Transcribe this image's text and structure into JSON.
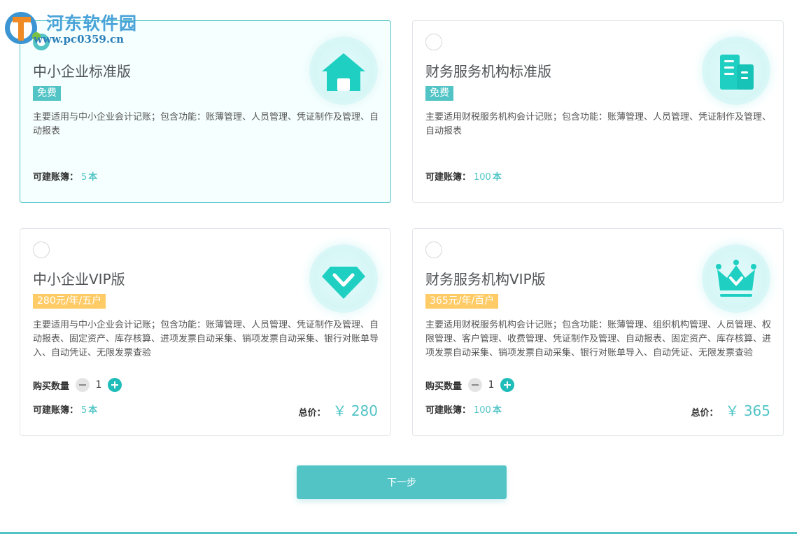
{
  "watermark": {
    "title": "河东软件园",
    "url": "www.pc0359.cn"
  },
  "colors": {
    "accent": "#52c4c6",
    "paid_badge": "#ffcb66",
    "plus_button": "#1fbcb9"
  },
  "plans": [
    {
      "title": "中小企业标准版",
      "badge": "免费",
      "selected": true,
      "icon": "house-icon",
      "description": "主要适用与中小企业会计记账；包含功能：账薄管理、人员管理、凭证制作及管理、自动报表",
      "books_label": "可建账簿：",
      "books_count": "5",
      "books_unit": "本"
    },
    {
      "title": "财务服务机构标准版",
      "badge": "免费",
      "selected": false,
      "icon": "building-icon",
      "description": "主要适用财税服务机构会计记账；包含功能：账薄管理、人员管理、凭证制作及管理、自动报表",
      "books_label": "可建账簿：",
      "books_count": "100",
      "books_unit": "本"
    },
    {
      "title": "中小企业VIP版",
      "badge": "280元/年/五户",
      "selected": false,
      "icon": "diamond-icon",
      "description": "主要适用与中小企业会计记账；包含功能：账薄管理、人员管理、凭证制作及管理、自动报表、固定资产、库存核算、进项发票自动采集、销项发票自动采集、银行对账单导入、自动凭证、无限发票查验",
      "quantity_label": "购买数量",
      "quantity": "1",
      "books_label": "可建账簿：",
      "books_count": "5",
      "books_unit": "本",
      "total_label": "总价：",
      "total_price": "￥ 280"
    },
    {
      "title": "财务服务机构VIP版",
      "badge": "365元/年/百户",
      "selected": false,
      "icon": "crown-icon",
      "description": "主要适用财税服务机构会计记账；包含功能：账薄管理、组织机构管理、人员管理、权限管理、客户管理、收费管理、凭证制作及管理、自动报表、固定资产、库存核算、进项发票自动采集、销项发票自动采集、银行对账单导入、自动凭证、无限发票查验",
      "quantity_label": "购买数量",
      "quantity": "1",
      "books_label": "可建账簿：",
      "books_count": "100",
      "books_unit": "本",
      "total_label": "总价：",
      "total_price": "￥ 365"
    }
  ],
  "next_button": "下一步"
}
